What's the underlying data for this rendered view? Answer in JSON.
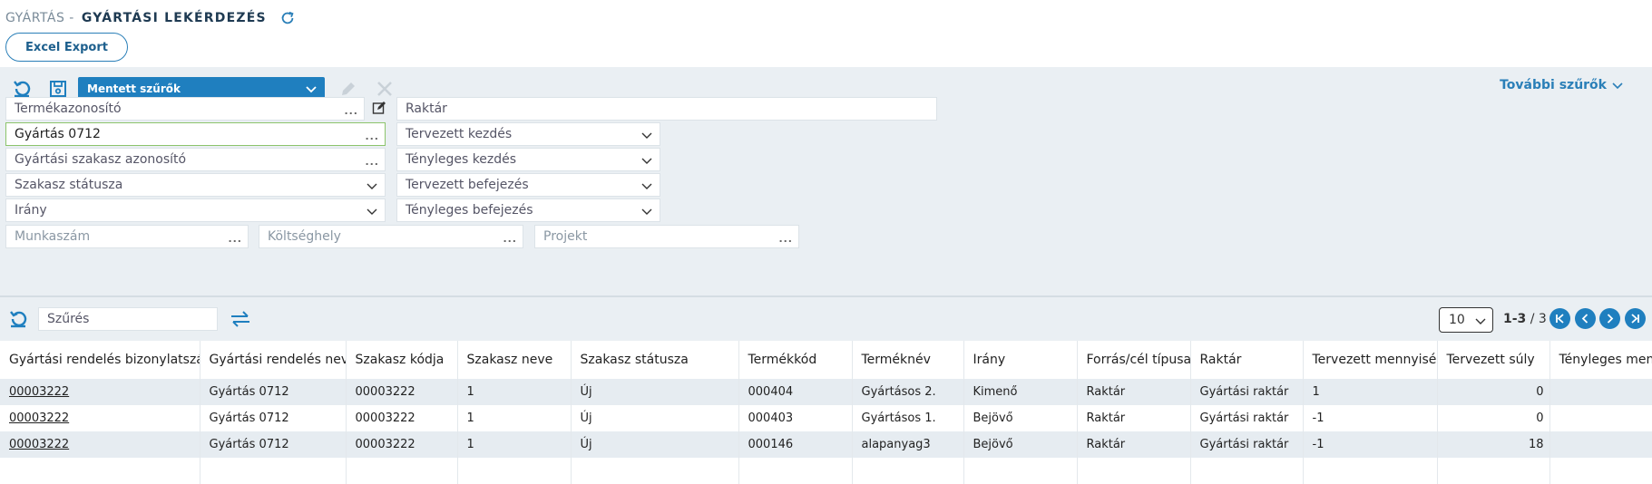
{
  "header": {
    "crumb": "GYÁRTÁS -",
    "title": "GYÁRTÁSI LEKÉRDEZÉS"
  },
  "toolbar": {
    "excel_label": "Excel Export"
  },
  "filters": {
    "saved_filters_label": "Mentett szűrők",
    "more_filters_label": "További szűrők",
    "termekazonosito": "Termékazonosító",
    "raktar": "Raktár",
    "gyartas_value": "Gyártás 0712",
    "szakasz_azonosito": "Gyártási szakasz azonosító",
    "szakasz_statusza": "Szakasz státusza",
    "irany": "Irány",
    "tervezett_kezdes": "Tervezett kezdés",
    "tenyleges_kezdes": "Tényleges kezdés",
    "tervezett_befejezes": "Tervezett befejezés",
    "tenyleges_befejezes": "Tényleges befejezés",
    "munkaszam": "Munkaszám",
    "koltseghely": "Költséghely",
    "projekt": "Projekt"
  },
  "grid_bar": {
    "search_label": "Szűrés",
    "page_size": "10",
    "page_range": "1-3",
    "page_total": "/ 3"
  },
  "columns": [
    "Gyártási rendelés bizonylatszáma",
    "Gyártási rendelés neve",
    "Szakasz kódja",
    "Szakasz neve",
    "Szakasz státusza",
    "Termékkód",
    "Terméknév",
    "Irány",
    "Forrás/cél típusa",
    "Raktár",
    "Tervezett mennyiség",
    "Tervezett súly",
    "Tényleges mennyiség"
  ],
  "rows": [
    [
      "00003222",
      "Gyártás 0712",
      "00003222",
      "1",
      "Új",
      "000404",
      "Gyártásos 2.",
      "Kimenő",
      "Raktár",
      "Gyártási raktár",
      "1",
      "0",
      ""
    ],
    [
      "00003222",
      "Gyártás 0712",
      "00003222",
      "1",
      "Új",
      "000403",
      "Gyártásos 1.",
      "Bejövő",
      "Raktár",
      "Gyártási raktár",
      "-1",
      "0",
      ""
    ],
    [
      "00003222",
      "Gyártás 0712",
      "00003222",
      "1",
      "Új",
      "000146",
      "alapanyag3",
      "Bejövő",
      "Raktár",
      "Gyártási raktár",
      "-1",
      "18",
      ""
    ]
  ],
  "colors": {
    "accent": "#1f7fbf",
    "panel": "#eaeff3",
    "active_border": "#8cc46b"
  }
}
